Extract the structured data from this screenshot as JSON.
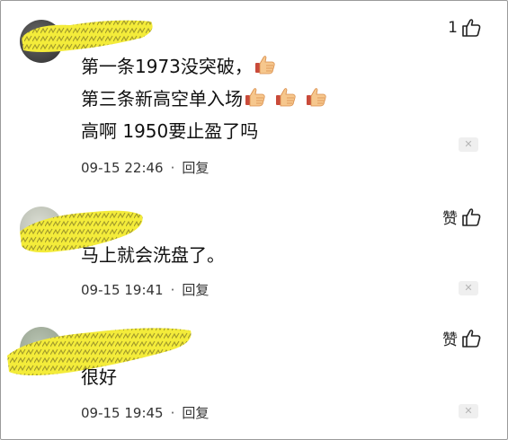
{
  "comments": [
    {
      "lines": [
        "第一条1973没突破，",
        "第三条新高空单入场",
        "高啊 1950要止盈了吗"
      ],
      "timestamp": "09-15 22:46",
      "reply_label": "回复",
      "like_label": "1",
      "icons": [
        "thumbs-up-icon",
        "close-icon"
      ]
    },
    {
      "lines": [
        "马上就会洗盘了。"
      ],
      "timestamp": "09-15 19:41",
      "reply_label": "回复",
      "like_label": "赞",
      "icons": [
        "thumbs-up-icon",
        "close-icon"
      ]
    },
    {
      "lines": [
        "很好"
      ],
      "timestamp": "09-15 19:45",
      "reply_label": "回复",
      "like_label": "赞",
      "icons": [
        "thumbs-up-icon",
        "close-icon"
      ]
    }
  ],
  "meta_separator": "·",
  "close_glyph": "✕",
  "colors": {
    "highlight": "#f3ea2e",
    "scribble": "#a9a12a",
    "emoji": "#f4b86a"
  }
}
